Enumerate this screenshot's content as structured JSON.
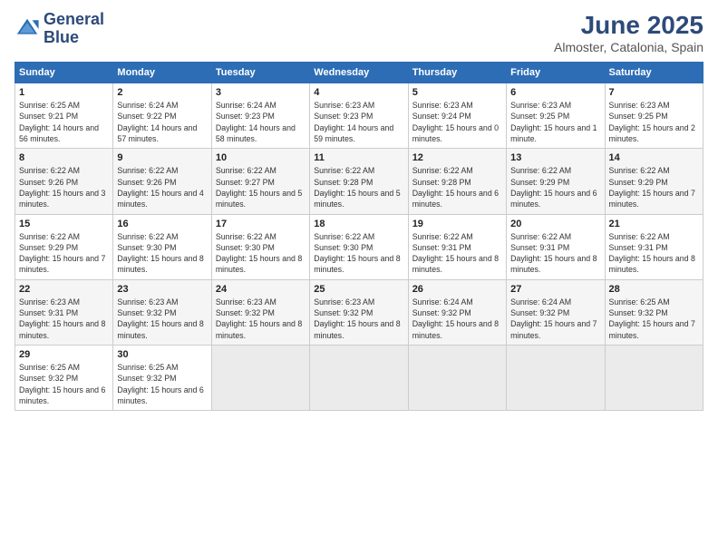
{
  "header": {
    "logo_line1": "General",
    "logo_line2": "Blue",
    "month": "June 2025",
    "location": "Almoster, Catalonia, Spain"
  },
  "weekdays": [
    "Sunday",
    "Monday",
    "Tuesday",
    "Wednesday",
    "Thursday",
    "Friday",
    "Saturday"
  ],
  "weeks": [
    [
      {
        "day": "1",
        "sunrise": "6:25 AM",
        "sunset": "9:21 PM",
        "daylight": "14 hours and 56 minutes."
      },
      {
        "day": "2",
        "sunrise": "6:24 AM",
        "sunset": "9:22 PM",
        "daylight": "14 hours and 57 minutes."
      },
      {
        "day": "3",
        "sunrise": "6:24 AM",
        "sunset": "9:23 PM",
        "daylight": "14 hours and 58 minutes."
      },
      {
        "day": "4",
        "sunrise": "6:23 AM",
        "sunset": "9:23 PM",
        "daylight": "14 hours and 59 minutes."
      },
      {
        "day": "5",
        "sunrise": "6:23 AM",
        "sunset": "9:24 PM",
        "daylight": "15 hours and 0 minutes."
      },
      {
        "day": "6",
        "sunrise": "6:23 AM",
        "sunset": "9:25 PM",
        "daylight": "15 hours and 1 minute."
      },
      {
        "day": "7",
        "sunrise": "6:23 AM",
        "sunset": "9:25 PM",
        "daylight": "15 hours and 2 minutes."
      }
    ],
    [
      {
        "day": "8",
        "sunrise": "6:22 AM",
        "sunset": "9:26 PM",
        "daylight": "15 hours and 3 minutes."
      },
      {
        "day": "9",
        "sunrise": "6:22 AM",
        "sunset": "9:26 PM",
        "daylight": "15 hours and 4 minutes."
      },
      {
        "day": "10",
        "sunrise": "6:22 AM",
        "sunset": "9:27 PM",
        "daylight": "15 hours and 5 minutes."
      },
      {
        "day": "11",
        "sunrise": "6:22 AM",
        "sunset": "9:28 PM",
        "daylight": "15 hours and 5 minutes."
      },
      {
        "day": "12",
        "sunrise": "6:22 AM",
        "sunset": "9:28 PM",
        "daylight": "15 hours and 6 minutes."
      },
      {
        "day": "13",
        "sunrise": "6:22 AM",
        "sunset": "9:29 PM",
        "daylight": "15 hours and 6 minutes."
      },
      {
        "day": "14",
        "sunrise": "6:22 AM",
        "sunset": "9:29 PM",
        "daylight": "15 hours and 7 minutes."
      }
    ],
    [
      {
        "day": "15",
        "sunrise": "6:22 AM",
        "sunset": "9:29 PM",
        "daylight": "15 hours and 7 minutes."
      },
      {
        "day": "16",
        "sunrise": "6:22 AM",
        "sunset": "9:30 PM",
        "daylight": "15 hours and 8 minutes."
      },
      {
        "day": "17",
        "sunrise": "6:22 AM",
        "sunset": "9:30 PM",
        "daylight": "15 hours and 8 minutes."
      },
      {
        "day": "18",
        "sunrise": "6:22 AM",
        "sunset": "9:30 PM",
        "daylight": "15 hours and 8 minutes."
      },
      {
        "day": "19",
        "sunrise": "6:22 AM",
        "sunset": "9:31 PM",
        "daylight": "15 hours and 8 minutes."
      },
      {
        "day": "20",
        "sunrise": "6:22 AM",
        "sunset": "9:31 PM",
        "daylight": "15 hours and 8 minutes."
      },
      {
        "day": "21",
        "sunrise": "6:22 AM",
        "sunset": "9:31 PM",
        "daylight": "15 hours and 8 minutes."
      }
    ],
    [
      {
        "day": "22",
        "sunrise": "6:23 AM",
        "sunset": "9:31 PM",
        "daylight": "15 hours and 8 minutes."
      },
      {
        "day": "23",
        "sunrise": "6:23 AM",
        "sunset": "9:32 PM",
        "daylight": "15 hours and 8 minutes."
      },
      {
        "day": "24",
        "sunrise": "6:23 AM",
        "sunset": "9:32 PM",
        "daylight": "15 hours and 8 minutes."
      },
      {
        "day": "25",
        "sunrise": "6:23 AM",
        "sunset": "9:32 PM",
        "daylight": "15 hours and 8 minutes."
      },
      {
        "day": "26",
        "sunrise": "6:24 AM",
        "sunset": "9:32 PM",
        "daylight": "15 hours and 8 minutes."
      },
      {
        "day": "27",
        "sunrise": "6:24 AM",
        "sunset": "9:32 PM",
        "daylight": "15 hours and 7 minutes."
      },
      {
        "day": "28",
        "sunrise": "6:25 AM",
        "sunset": "9:32 PM",
        "daylight": "15 hours and 7 minutes."
      }
    ],
    [
      {
        "day": "29",
        "sunrise": "6:25 AM",
        "sunset": "9:32 PM",
        "daylight": "15 hours and 6 minutes."
      },
      {
        "day": "30",
        "sunrise": "6:25 AM",
        "sunset": "9:32 PM",
        "daylight": "15 hours and 6 minutes."
      },
      null,
      null,
      null,
      null,
      null
    ]
  ]
}
